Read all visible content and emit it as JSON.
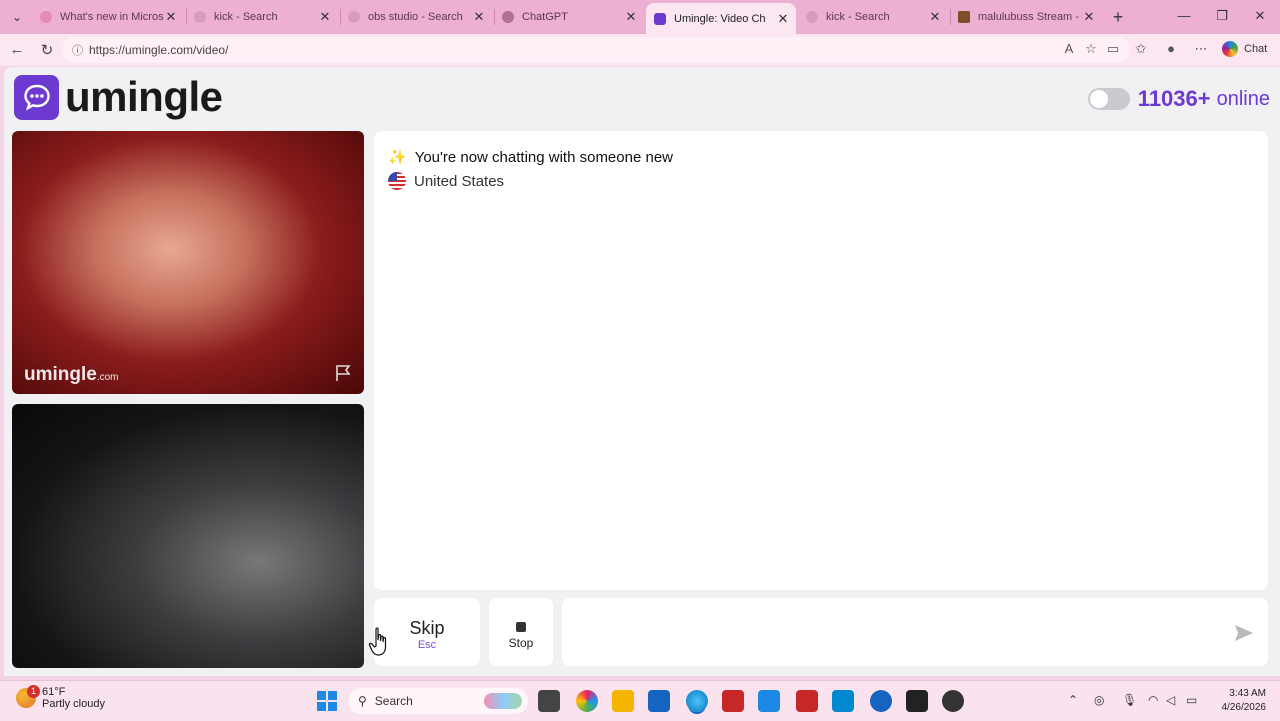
{
  "browser": {
    "tabs": [
      {
        "title": "What's new in Microso",
        "active": false
      },
      {
        "title": "kick - Search",
        "active": false
      },
      {
        "title": "obs studio - Search",
        "active": false
      },
      {
        "title": "ChatGPT",
        "active": false
      },
      {
        "title": "Umingle: Video Ch",
        "active": true
      },
      {
        "title": "kick - Search",
        "active": false
      },
      {
        "title": "malulubuss Stream - W",
        "active": false
      }
    ],
    "url": "https://umingle.com/video/",
    "chat_label": "Chat"
  },
  "site": {
    "logo_text": "umingle",
    "online_count": "11036+",
    "online_label": "online",
    "watermark_main": "umingle",
    "watermark_domain": ".com"
  },
  "chat": {
    "sparkle": "✨",
    "status_message": "You're now chatting with someone new",
    "country": "United States"
  },
  "controls": {
    "skip_label": "Skip",
    "skip_key": "Esc",
    "stop_label": "Stop"
  },
  "taskbar": {
    "temperature": "61°F",
    "condition": "Partly cloudy",
    "notification_count": "1",
    "search_label": "Search",
    "time": "3:43 AM",
    "date": "4/26/2026"
  },
  "colors": {
    "accent": "#6c3ad1",
    "tab_strip": "#eeb0d2"
  }
}
